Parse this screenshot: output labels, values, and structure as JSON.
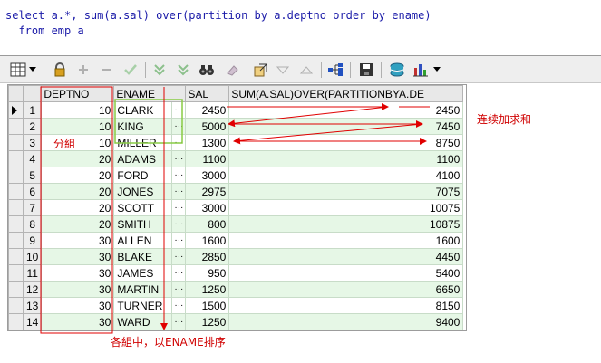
{
  "editor": {
    "line1": "select a.*, sum(a.sal) over(partition by a.deptno order by ename)",
    "line2": "  from emp a"
  },
  "toolbar": {
    "icons": [
      "grid-icon",
      "lock-icon",
      "add-icon",
      "remove-icon",
      "check-icon",
      "filter-down-icon",
      "filter-clear-icon",
      "binoculars-icon",
      "eraser-icon",
      "export-icon",
      "sort-down-icon",
      "sort-up-icon",
      "tree-icon",
      "save-icon",
      "database-icon",
      "chart-icon"
    ]
  },
  "grid": {
    "columns": [
      "DEPTNO",
      "ENAME",
      "SAL",
      "SUM(A.SAL)OVER(PARTITIONBYA.DE"
    ],
    "rows": [
      {
        "n": "1",
        "deptno": "10",
        "ename": "CLARK",
        "sal": "2450",
        "sum": "2450"
      },
      {
        "n": "2",
        "deptno": "10",
        "ename": "KING",
        "sal": "5000",
        "sum": "7450"
      },
      {
        "n": "3",
        "deptno": "10",
        "ename": "MILLER",
        "sal": "1300",
        "sum": "8750"
      },
      {
        "n": "4",
        "deptno": "20",
        "ename": "ADAMS",
        "sal": "1100",
        "sum": "1100"
      },
      {
        "n": "5",
        "deptno": "20",
        "ename": "FORD",
        "sal": "3000",
        "sum": "4100"
      },
      {
        "n": "6",
        "deptno": "20",
        "ename": "JONES",
        "sal": "2975",
        "sum": "7075"
      },
      {
        "n": "7",
        "deptno": "20",
        "ename": "SCOTT",
        "sal": "3000",
        "sum": "10075"
      },
      {
        "n": "8",
        "deptno": "20",
        "ename": "SMITH",
        "sal": "800",
        "sum": "10875"
      },
      {
        "n": "9",
        "deptno": "30",
        "ename": "ALLEN",
        "sal": "1600",
        "sum": "1600"
      },
      {
        "n": "10",
        "deptno": "30",
        "ename": "BLAKE",
        "sal": "2850",
        "sum": "4450"
      },
      {
        "n": "11",
        "deptno": "30",
        "ename": "JAMES",
        "sal": "950",
        "sum": "5400"
      },
      {
        "n": "12",
        "deptno": "30",
        "ename": "MARTIN",
        "sal": "1250",
        "sum": "6650"
      },
      {
        "n": "13",
        "deptno": "30",
        "ename": "TURNER",
        "sal": "1500",
        "sum": "8150"
      },
      {
        "n": "14",
        "deptno": "30",
        "ename": "WARD",
        "sal": "1250",
        "sum": "9400"
      }
    ],
    "dots": "···"
  },
  "annotations": {
    "group": "分組",
    "running_sum": "连续加求和",
    "order_note": "各組中，以ENAME排序"
  },
  "colors": {
    "annotation": "#d00000",
    "row_alt": "#e6f7e6",
    "sql_text": "#1a1aa8",
    "highlight_box": "#88cc44"
  }
}
